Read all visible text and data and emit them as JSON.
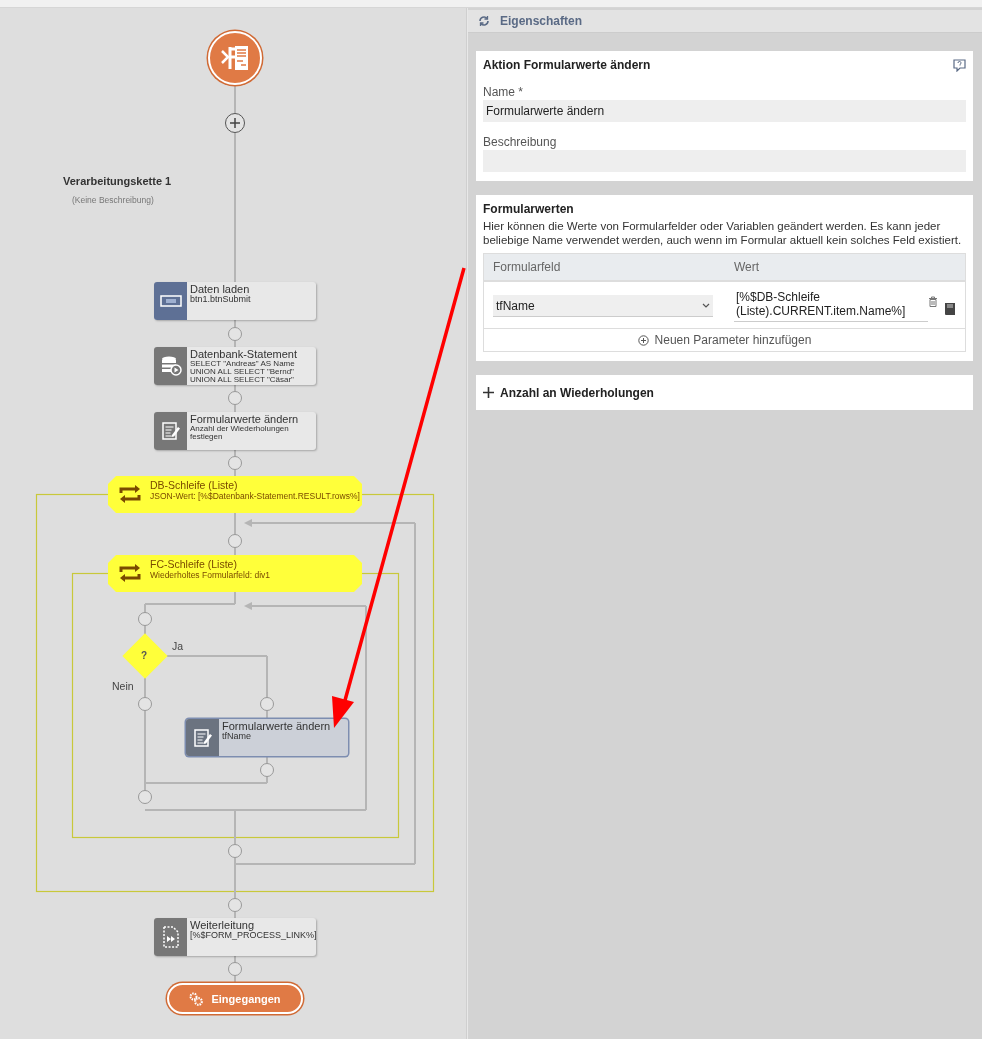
{
  "canvas": {
    "chain_title": "Verarbeitungskette 1",
    "chain_description": "(Keine Beschreibung)",
    "nodes": [
      {
        "kind": "start"
      },
      {
        "kind": "add"
      },
      {
        "kind": "action",
        "title": "Daten laden",
        "lines": [
          "btn1.btnSubmit"
        ],
        "selected": false
      },
      {
        "kind": "action",
        "title": "Datenbank-Statement",
        "lines": [
          "SELECT \"Andreas\" AS Name",
          "UNION ALL SELECT \"Bernd\"",
          "UNION ALL SELECT \"Cäsar\""
        ],
        "selected": false
      },
      {
        "kind": "action",
        "title": "Formularwerte ändern",
        "lines": [
          "Anzahl der Wiederholungen festlegen"
        ],
        "selected": false
      },
      {
        "kind": "loop",
        "title": "DB-Schleife (Liste)",
        "detail": "JSON-Wert: [%$Datenbank-Statement.RESULT.rows%]"
      },
      {
        "kind": "loop",
        "title": "FC-Schleife (Liste)",
        "detail": "Wiederholtes Formularfeld: div1"
      },
      {
        "kind": "decision",
        "label": "?",
        "yes_label": "Ja",
        "no_label": "Nein"
      },
      {
        "kind": "action",
        "title": "Formularwerte ändern",
        "lines": [
          "tfName"
        ],
        "selected": true
      },
      {
        "kind": "action",
        "title": "Weiterleitung",
        "lines": [
          "[%$FORM_PROCESS_LINK%]"
        ],
        "selected": false
      },
      {
        "kind": "end",
        "label": "Eingegangen"
      }
    ]
  },
  "properties": {
    "title": "Eigenschaften",
    "action_card": {
      "title": "Aktion Formularwerte ändern",
      "fields": [
        {
          "label": "Name *",
          "value": "Formularwerte ändern"
        },
        {
          "label": "Beschreibung"
        }
      ]
    },
    "values_card": {
      "title": "Formularwerten",
      "description": "Hier können die Werte von Formularfelder oder Variablen geändert werden. Es kann jeder beliebige Name verwendet werden, auch wenn im Formular aktuell kein solches Feld existiert.",
      "columns": [
        "Formularfeld",
        "Wert"
      ],
      "rows": [
        {
          "field": "tfName",
          "value": "[%$DB-Schleife (Liste).CURRENT.item.Name%]"
        }
      ],
      "add_button": "Neuen Parameter hinzufügen"
    },
    "repeat_section": {
      "title": "Anzahl an Wiederholungen",
      "expanded": false
    }
  }
}
